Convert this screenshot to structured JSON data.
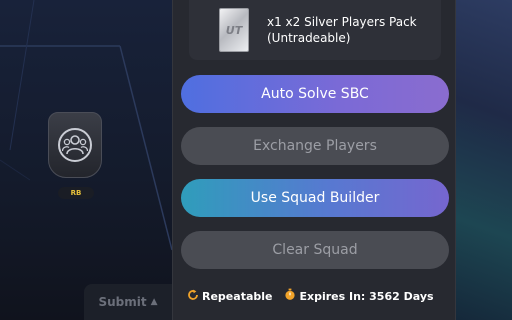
{
  "pitch": {
    "position_label": "RB",
    "submit_label": "Submit",
    "submit_icon": "triangle-up-icon"
  },
  "reward": {
    "title": "x1 x2 Silver Players Pack (Untradeable)",
    "pack_logo": "UT",
    "pack_icon": "silver-pack-icon"
  },
  "buttons": {
    "auto_solve": "Auto Solve SBC",
    "exchange": "Exchange Players",
    "squad_builder": "Use Squad Builder",
    "clear": "Clear Squad"
  },
  "footer": {
    "repeatable": "Repeatable",
    "expires": "Expires In: 3562 Days",
    "repeat_icon": "repeat-icon",
    "clock_icon": "stopwatch-icon"
  },
  "colors": {
    "accent_gradient_start": "#4f6fe0",
    "accent_gradient_end": "#8a6ccf",
    "builder_gradient_start": "#2f9dbb",
    "disabled_button": "#4a4c53",
    "panel_bg": "#272930",
    "position_badge_text": "#e9c23b",
    "icon_orange": "#f0a32a"
  }
}
